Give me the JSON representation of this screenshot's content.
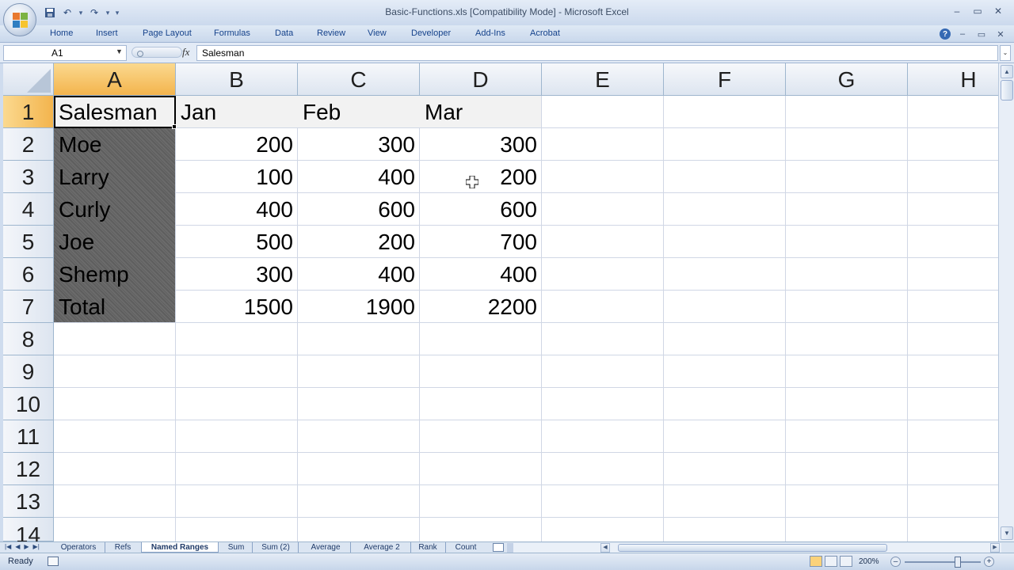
{
  "window": {
    "title": "Basic-Functions.xls  [Compatibility Mode] - Microsoft Excel",
    "qat_undo": "↶",
    "qat_redo": "↷",
    "qat_more": "▾",
    "minimize": "–",
    "restore": "▭",
    "close": "✕"
  },
  "ribbon": {
    "tabs": [
      "Home",
      "Insert",
      "Page Layout",
      "Formulas",
      "Data",
      "Review",
      "View",
      "Developer",
      "Add-Ins",
      "Acrobat"
    ],
    "help": "?",
    "minimize": "–",
    "restore": "▭",
    "close": "✕"
  },
  "formula_bar": {
    "name_box": "A1",
    "fx": "fx",
    "content": "Salesman"
  },
  "grid": {
    "columns": [
      "A",
      "B",
      "C",
      "D",
      "E",
      "F",
      "G",
      "H"
    ],
    "rows": [
      "1",
      "2",
      "3",
      "4",
      "5",
      "6",
      "7",
      "8",
      "9",
      "10",
      "11",
      "12",
      "13",
      "14"
    ],
    "header_row": [
      "Salesman",
      "Jan",
      "Feb",
      "Mar"
    ],
    "data_rows": [
      [
        "Moe",
        "200",
        "300",
        "300"
      ],
      [
        "Larry",
        "100",
        "400",
        "200"
      ],
      [
        "Curly",
        "400",
        "600",
        "600"
      ],
      [
        "Joe",
        "500",
        "200",
        "700"
      ],
      [
        "Shemp",
        "300",
        "400",
        "400"
      ],
      [
        "Total",
        "1500",
        "1900",
        "2200"
      ]
    ]
  },
  "sheet_tabs": {
    "items": [
      "Operators",
      "Refs",
      "Named Ranges",
      "Sum",
      "Sum (2)",
      "Average",
      "Average 2",
      "Rank",
      "Count"
    ],
    "active": "Named Ranges"
  },
  "status": {
    "mode": "Ready",
    "zoom": "200%"
  },
  "colors": {
    "selected_header": "#f3b44d",
    "header_cells": "#f2f2f2",
    "ribbon_text": "#15428b"
  }
}
